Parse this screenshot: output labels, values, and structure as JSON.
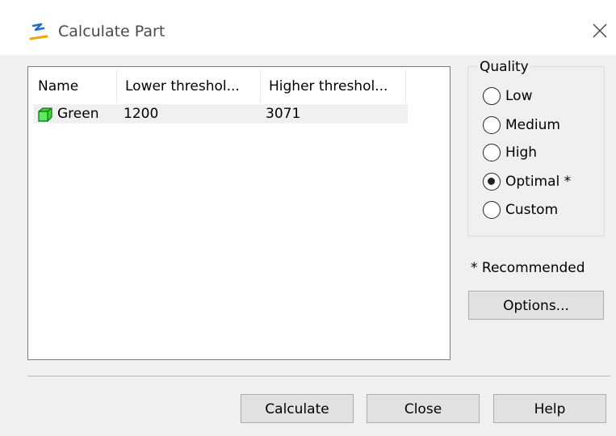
{
  "window": {
    "title": "Calculate Part",
    "close_icon": "close-icon",
    "app_icon": "app-logo-icon"
  },
  "parts_list": {
    "columns": [
      "Name",
      "Lower threshol...",
      "Higher threshol..."
    ],
    "rows": [
      {
        "name": "Green",
        "lower": "1200",
        "higher": "3071",
        "icon": "green-cube-icon",
        "color": "#3cd83c"
      }
    ]
  },
  "quality": {
    "legend": "Quality",
    "options": [
      "Low",
      "Medium",
      "High",
      "Optimal *",
      "Custom"
    ],
    "selected": "Optimal *"
  },
  "recommended_note": "* Recommended",
  "buttons": {
    "options": "Options...",
    "calculate": "Calculate",
    "close": "Close",
    "help": "Help"
  },
  "colors": {
    "accent_blue": "#1e6fd0",
    "accent_orange": "#f0a400",
    "selection_row": "#f0f0f0"
  }
}
